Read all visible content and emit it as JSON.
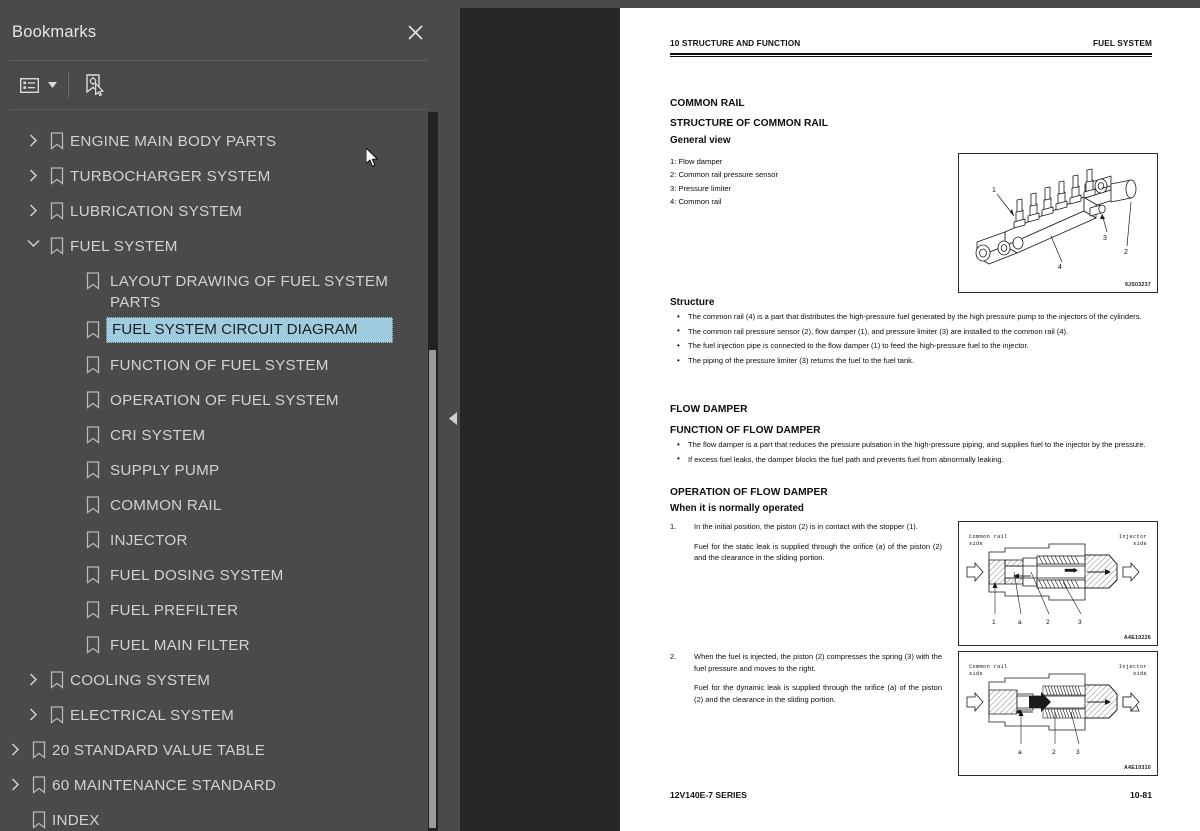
{
  "panel": {
    "title": "Bookmarks",
    "close_icon": "close-icon",
    "toolbar": {
      "options_icon": "list-options-icon",
      "caret_icon": "chevron-down-icon",
      "new_bookmark_icon": "new-bookmark-icon"
    }
  },
  "tree": {
    "items": [
      {
        "label": "ENGINE MAIN BODY PARTS",
        "level": 1,
        "twisty": "collapsed",
        "selected": false
      },
      {
        "label": "TURBOCHARGER SYSTEM",
        "level": 1,
        "twisty": "collapsed",
        "selected": false
      },
      {
        "label": "LUBRICATION SYSTEM",
        "level": 1,
        "twisty": "collapsed",
        "selected": false
      },
      {
        "label": "FUEL SYSTEM",
        "level": 1,
        "twisty": "expanded",
        "selected": false
      },
      {
        "label": "LAYOUT DRAWING OF FUEL SYSTEM PARTS",
        "level": 2,
        "twisty": "none",
        "selected": false
      },
      {
        "label": "FUEL SYSTEM CIRCUIT DIAGRAM",
        "level": 2,
        "twisty": "none",
        "selected": true
      },
      {
        "label": "FUNCTION OF FUEL SYSTEM",
        "level": 2,
        "twisty": "none",
        "selected": false
      },
      {
        "label": "OPERATION OF FUEL SYSTEM",
        "level": 2,
        "twisty": "none",
        "selected": false
      },
      {
        "label": "CRI SYSTEM",
        "level": 2,
        "twisty": "none",
        "selected": false
      },
      {
        "label": "SUPPLY PUMP",
        "level": 2,
        "twisty": "none",
        "selected": false
      },
      {
        "label": "COMMON RAIL",
        "level": 2,
        "twisty": "none",
        "selected": false
      },
      {
        "label": "INJECTOR",
        "level": 2,
        "twisty": "none",
        "selected": false
      },
      {
        "label": "FUEL DOSING SYSTEM",
        "level": 2,
        "twisty": "none",
        "selected": false
      },
      {
        "label": "FUEL PREFILTER",
        "level": 2,
        "twisty": "none",
        "selected": false
      },
      {
        "label": "FUEL MAIN FILTER",
        "level": 2,
        "twisty": "none",
        "selected": false
      },
      {
        "label": "COOLING SYSTEM",
        "level": 1,
        "twisty": "collapsed",
        "selected": false
      },
      {
        "label": "ELECTRICAL SYSTEM",
        "level": 1,
        "twisty": "collapsed",
        "selected": false
      },
      {
        "label": "20 STANDARD VALUE TABLE",
        "level": 0,
        "twisty": "collapsed",
        "selected": false
      },
      {
        "label": "60 MAINTENANCE STANDARD",
        "level": 0,
        "twisty": "collapsed",
        "selected": false
      },
      {
        "label": "INDEX",
        "level": 0,
        "twisty": "none",
        "selected": false
      }
    ]
  },
  "document": {
    "header_left": "10 STRUCTURE AND FUNCTION",
    "header_right": "FUEL SYSTEM",
    "footer_left": "12V140E-7 SERIES",
    "footer_right": "10-81",
    "h_common_rail": "COMMON RAIL",
    "h_structure_of_common_rail": "STRUCTURE OF COMMON RAIL",
    "h_general_view": "General view",
    "legend": [
      "1: Flow damper",
      "2: Common rail pressure sensor",
      "3: Pressure limiter",
      "4: Common rail"
    ],
    "h_structure": "Structure",
    "structure_bullets": [
      "The common rail (4) is a part that distributes the high-pressure fuel generated by the high pressure pump to the injectors of the cylinders.",
      "The common rail pressure sensor (2), flow damper (1), and pressure limiter (3) are installed to the common rail (4).",
      "The fuel injection pipe is connected to the flow damper (1) to feed the high-pressure fuel to the injector.",
      "The piping of the pressure limiter (3) returns the fuel to the fuel tank."
    ],
    "h_flow_damper": "FLOW DAMPER",
    "h_function_of_flow_damper": "FUNCTION OF FLOW DAMPER",
    "function_bullets": [
      "The flow damper is a part that reduces the pressure pulsation in the high-pressure piping, and supplies fuel to the injector by the pressure.",
      "If excess fuel leaks, the damper blocks the fuel path and prevents fuel from abnormally leaking."
    ],
    "h_operation_of_flow_damper": "OPERATION OF FLOW DAMPER",
    "h_when_normally_operated": "When it is normally operated",
    "step1": {
      "number": "1.",
      "p1": "In the initial position, the piston (2) is in contact with the stopper (1).",
      "p2": "Fuel for the static leak is supplied through the orifice (a) of the piston (2) and the clearance in the sliding portion."
    },
    "step2": {
      "number": "2.",
      "p1": "When the fuel is injected, the piston (2) compresses the spring (3) with the fuel pressure and moves to the right.",
      "p2": "Fuel for the dynamic leak is supplied through the orifice (a) of the piston (2) and the clearance in the sliding portion."
    },
    "figures": {
      "common_rail": {
        "id": "9JS03237",
        "callouts": [
          "1",
          "2",
          "3",
          "4"
        ]
      },
      "damper_normal": {
        "id": "A4E10226",
        "left_label": "Common rail\nside",
        "right_label": "Injector\nside",
        "callouts": [
          "1",
          "a",
          "2",
          "3"
        ]
      },
      "damper_injected": {
        "id": "A4E10310",
        "left_label": "Common rail\nside",
        "right_label": "Injector\nside",
        "callouts": [
          "a",
          "2",
          "3"
        ]
      }
    }
  },
  "colors": {
    "panel_bg": "#4a4a4a",
    "viewer_bg": "#262626",
    "selection": "#9fccdf",
    "page": "#ffffff",
    "text": "#d2d2d2"
  }
}
